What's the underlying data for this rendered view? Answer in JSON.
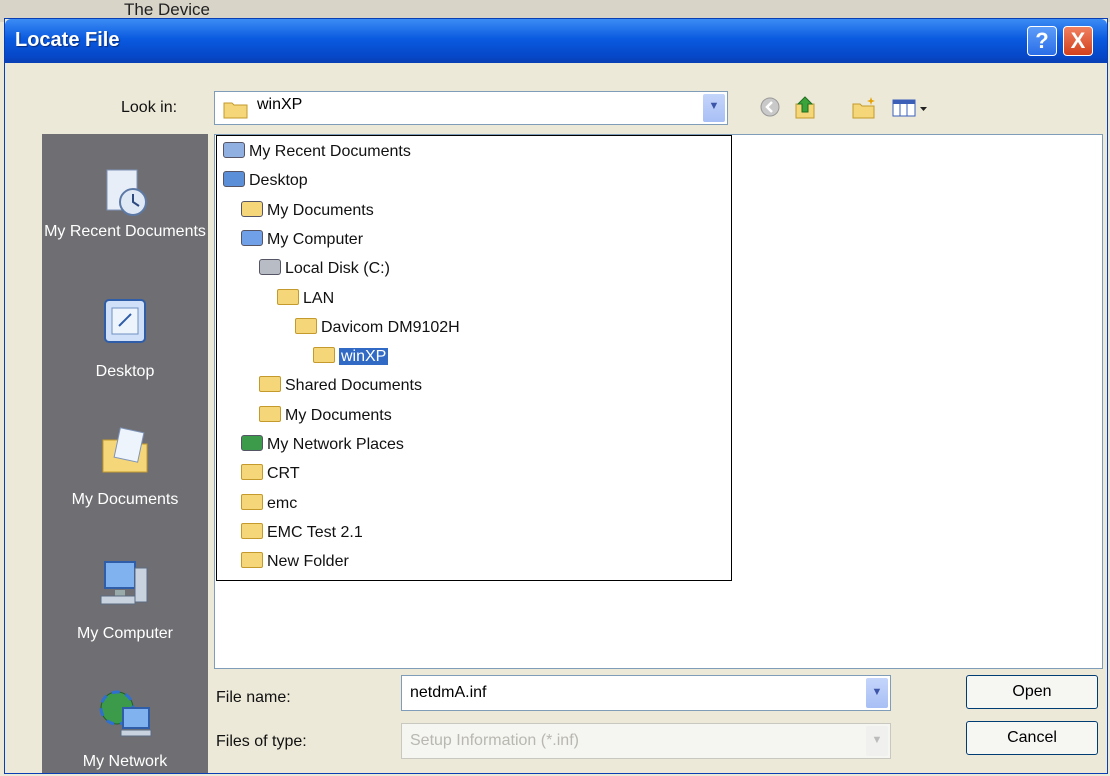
{
  "background_window": {
    "title": "The Device"
  },
  "dialog": {
    "title": "Locate File",
    "help_label": "?",
    "close_label": "X"
  },
  "look_in": {
    "label": "Look in:",
    "value": "winXP"
  },
  "toolbar": {
    "icons": [
      "back-icon",
      "up-folder-icon",
      "new-folder-icon",
      "views-menu-icon"
    ]
  },
  "places_bar": [
    {
      "label": "My Recent Documents",
      "icon": "recent-documents-icon"
    },
    {
      "label": "Desktop",
      "icon": "desktop-icon"
    },
    {
      "label": "My Documents",
      "icon": "my-documents-icon"
    },
    {
      "label": "My Computer",
      "icon": "my-computer-icon"
    },
    {
      "label": "My Network",
      "icon": "network-icon"
    }
  ],
  "dropdown_items": [
    {
      "label": "My Recent Documents",
      "icon": "recent-documents-icon",
      "level": 0
    },
    {
      "label": "Desktop",
      "icon": "desktop-icon",
      "level": 0
    },
    {
      "label": "My Documents",
      "icon": "my-documents-icon",
      "level": 1
    },
    {
      "label": "My Computer",
      "icon": "my-computer-icon",
      "level": 1
    },
    {
      "label": "Local Disk (C:)",
      "icon": "drive-icon",
      "level": 2
    },
    {
      "label": "LAN",
      "icon": "folder-icon",
      "level": 3
    },
    {
      "label": "Davicom DM9102H",
      "icon": "folder-icon",
      "level": 4
    },
    {
      "label": "winXP",
      "icon": "folder-icon",
      "level": 5,
      "selected": true
    },
    {
      "label": "Shared Documents",
      "icon": "folder-icon",
      "level": 2
    },
    {
      "label": "My Documents",
      "icon": "folder-icon",
      "level": 2
    },
    {
      "label": "My Network Places",
      "icon": "network-icon",
      "level": 1
    },
    {
      "label": "CRT",
      "icon": "folder-icon",
      "level": 1
    },
    {
      "label": "emc",
      "icon": "folder-icon",
      "level": 1
    },
    {
      "label": "EMC Test 2.1",
      "icon": "folder-icon",
      "level": 1
    },
    {
      "label": "New Folder",
      "icon": "folder-icon",
      "level": 1
    }
  ],
  "file_name": {
    "label": "File name:",
    "value": "netdmA.inf"
  },
  "file_type": {
    "label": "Files of type:",
    "value": "Setup Information (*.inf)"
  },
  "buttons": {
    "open": "Open",
    "cancel": "Cancel"
  }
}
